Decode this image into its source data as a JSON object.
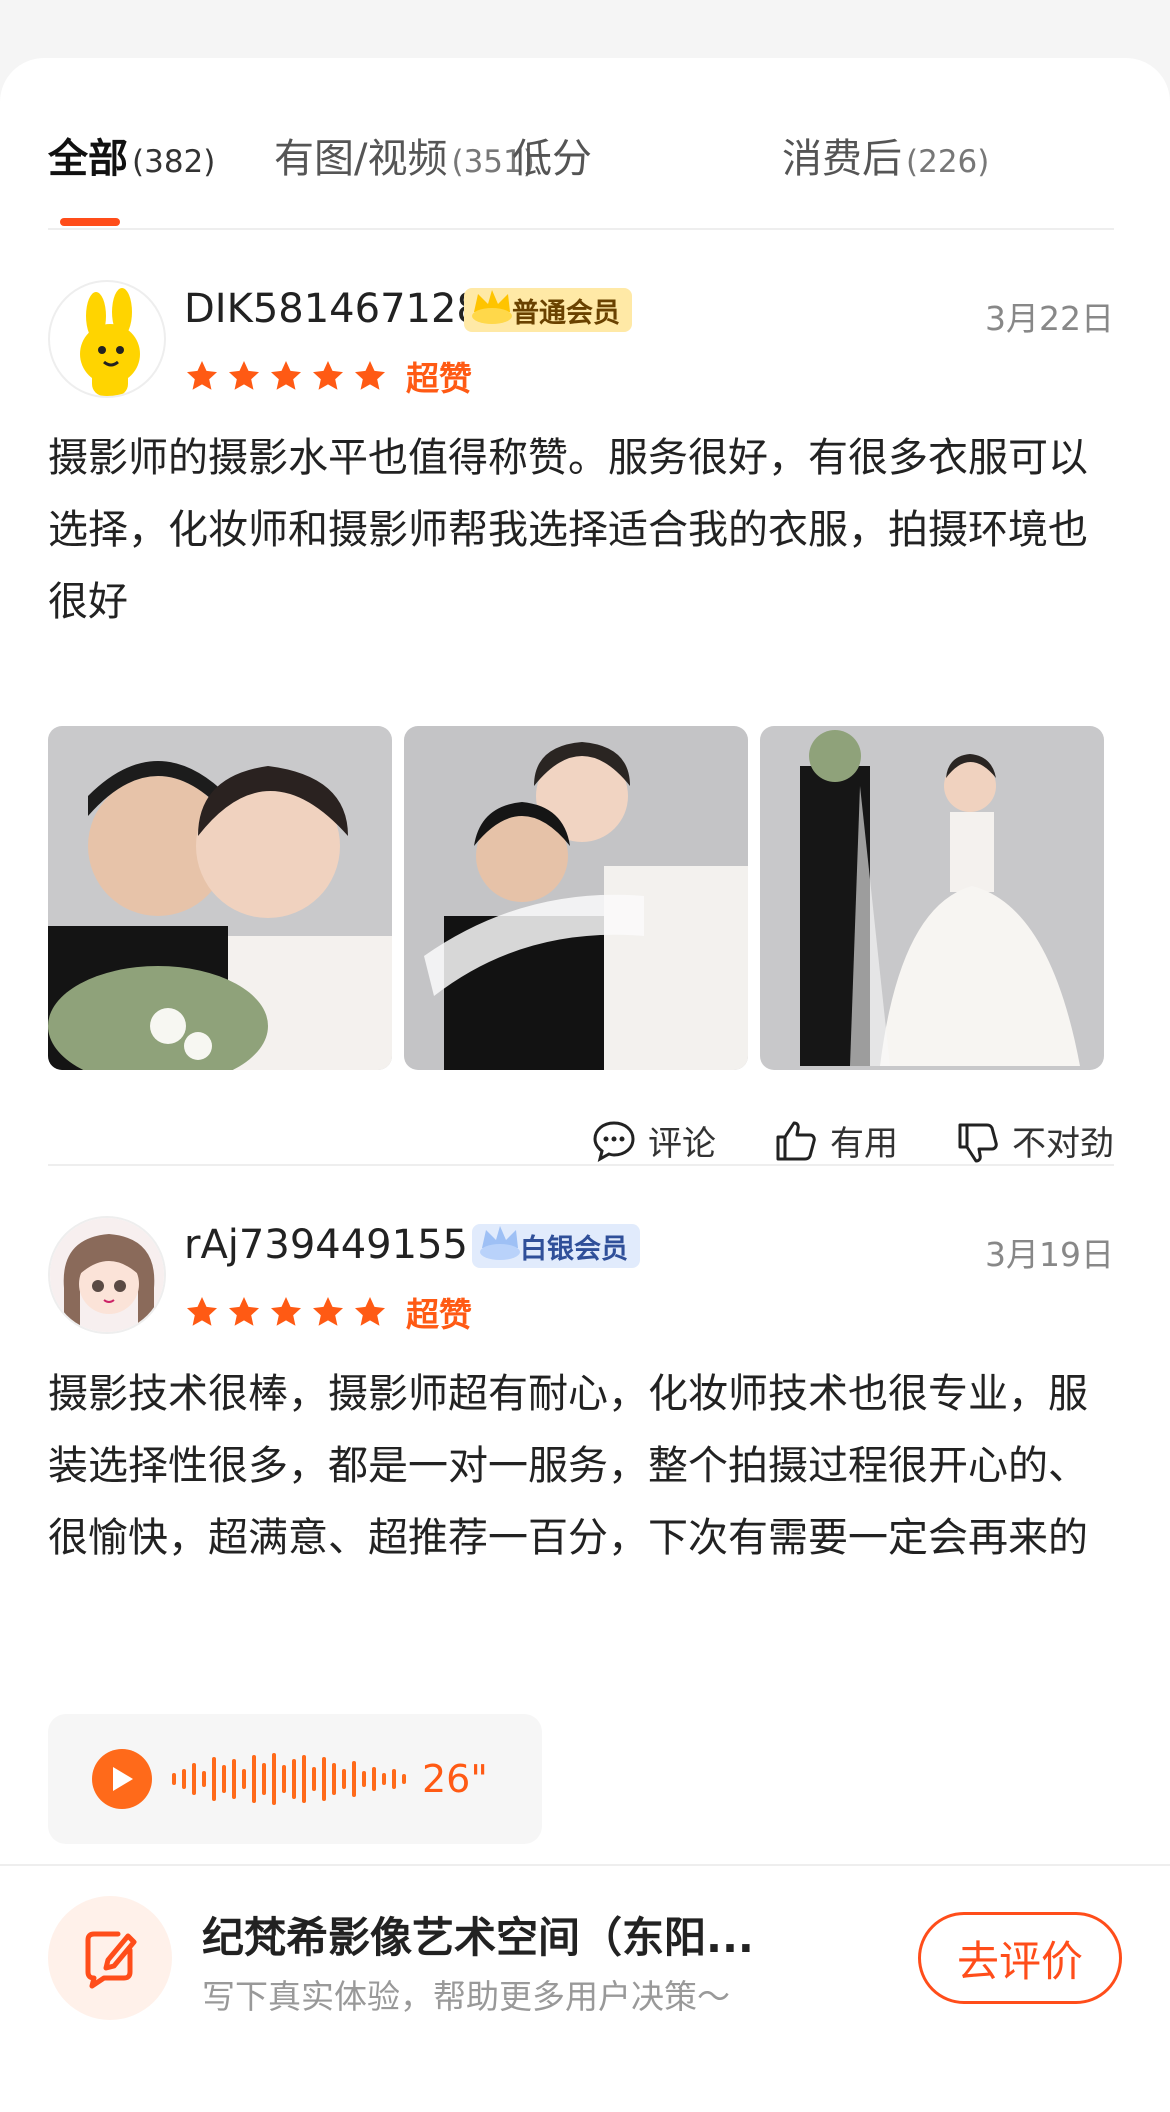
{
  "tabs": [
    {
      "label": "全部",
      "count": "(382)"
    },
    {
      "label": "有图/视频",
      "count": "(351)"
    },
    {
      "label": "低分",
      "count": ""
    },
    {
      "label": "消费后",
      "count": "(226)"
    }
  ],
  "accent_color": "#ff4d1a",
  "reviews": [
    {
      "username": "DIK581467128",
      "member_level": "普通会员",
      "date": "3月22日",
      "stars": 5,
      "rating_label": "超赞",
      "text": "摄影师的摄影水平也值得称赞。服务很好，有很多衣服可以选择，化妆师和摄影师帮我选择适合我的衣服，拍摄环境也很好",
      "photo_count": 3
    },
    {
      "username": "rAj739449155",
      "member_level": "白银会员",
      "date": "3月19日",
      "stars": 5,
      "rating_label": "超赞",
      "text": "摄影技术很棒，摄影师超有耐心，化妆师技术也很专业，服装选择性很多，都是一对一服务，整个拍摄过程很开心的、很愉快，超满意、超推荐一百分，下次有需要一定会再来的",
      "voice_duration": "26\""
    }
  ],
  "actions": {
    "comment": "评论",
    "useful": "有用",
    "wrong": "不对劲"
  },
  "bottom_bar": {
    "title": "纪梵希影像艺术空间（东阳...",
    "subtitle": "写下真实体验，帮助更多用户决策～",
    "button": "去评价"
  }
}
